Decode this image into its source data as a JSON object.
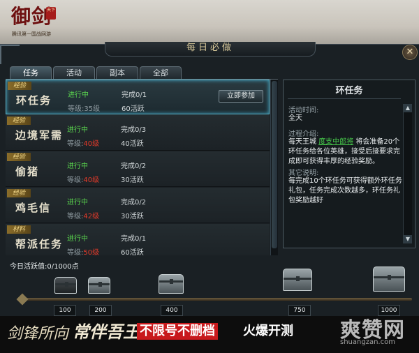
{
  "logo": {
    "title": "御剑",
    "tagline": "腾讯第一国战网游",
    "seal": "天下"
  },
  "window": {
    "title": "每日必做",
    "close_icon": "close-icon"
  },
  "tabs": [
    {
      "label": "任务",
      "active": true
    },
    {
      "label": "活动",
      "active": false
    },
    {
      "label": "副本",
      "active": false
    },
    {
      "label": "全部",
      "active": false
    }
  ],
  "quests": [
    {
      "tag": "经验",
      "name": "环任务",
      "status": "进行中",
      "level_prefix": "等级:",
      "level": "35级",
      "level_red": false,
      "progress": "完成0/1",
      "points": "60活跃",
      "join": "立即参加",
      "selected": true
    },
    {
      "tag": "经验",
      "name": "边境军需",
      "status": "进行中",
      "level_prefix": "等级:",
      "level": "40级",
      "level_red": true,
      "progress": "完成0/3",
      "points": "40活跃",
      "selected": false
    },
    {
      "tag": "经验",
      "name": "偷猪",
      "status": "进行中",
      "level_prefix": "等级:",
      "level": "40级",
      "level_red": true,
      "progress": "完成0/2",
      "points": "30活跃",
      "selected": false
    },
    {
      "tag": "经验",
      "name": "鸡毛信",
      "status": "进行中",
      "level_prefix": "等级:",
      "level": "42级",
      "level_red": true,
      "progress": "完成0/2",
      "points": "30活跃",
      "selected": false
    },
    {
      "tag": "材料",
      "name": "帮派任务",
      "status": "进行中",
      "level_prefix": "等级:",
      "level": "50级",
      "level_red": true,
      "progress": "完成0/1",
      "points": "60活跃",
      "selected": false
    }
  ],
  "detail": {
    "title": "环任务",
    "time_label": "活动时间:",
    "time_value": "全天",
    "intro_label": "过程介绍:",
    "intro_pre": "每天王城 ",
    "intro_link": "度支中郎将",
    "intro_post": " 将会准备20个环任务给各位英雄，接受后接要求完成即可获得丰厚的经验奖励。",
    "other_label": "其它说明:",
    "other_value": "每完成10个环任务可获得额外环任务礼包，任务完成次数越多，环任务礼包奖励越好"
  },
  "activity": {
    "label": "今日活跃值:0/1000点",
    "milestones": [
      {
        "value": "100"
      },
      {
        "value": "200"
      },
      {
        "value": "400"
      },
      {
        "value": "750"
      },
      {
        "value": "1000"
      }
    ]
  },
  "banner": {
    "brush1": "剑锋所向",
    "brush2": "常伴吾王",
    "red": "不限号不删档",
    "white": "火爆开测"
  },
  "watermark": {
    "main": "爽赞网",
    "url": "shuangzan.com"
  }
}
